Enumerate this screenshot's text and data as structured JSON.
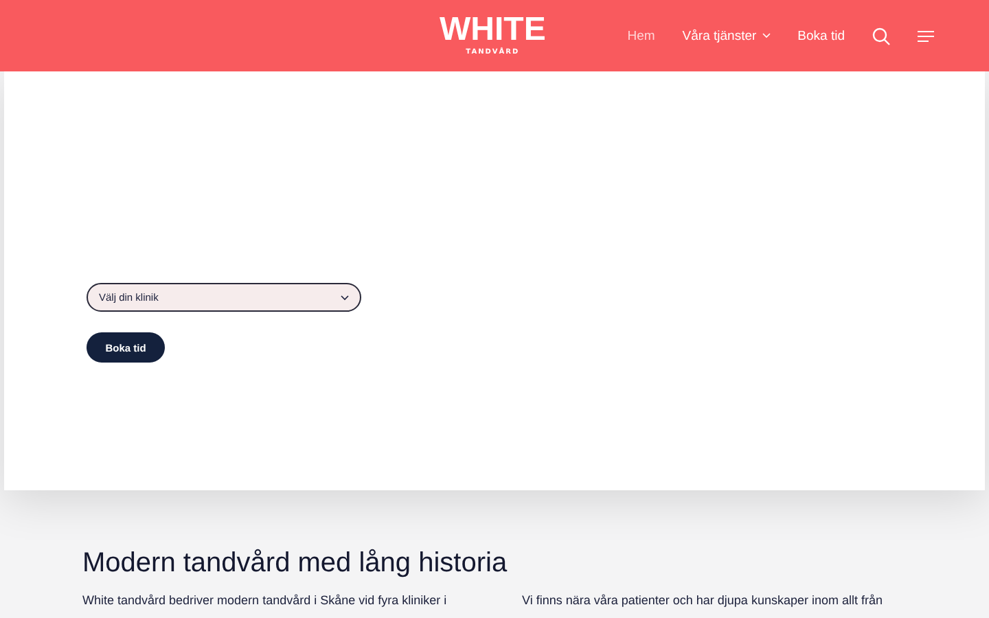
{
  "header": {
    "logo": {
      "word": "WHITE",
      "sub": "TANDVÅRD"
    },
    "nav": [
      {
        "label": "Hem",
        "kind": "link",
        "dimmed": true
      },
      {
        "label": "Våra tjänster",
        "kind": "dropdown",
        "dimmed": false
      },
      {
        "label": "Boka tid",
        "kind": "link",
        "dimmed": false
      }
    ]
  },
  "booking": {
    "select": {
      "placeholder": "Välj din klinik"
    },
    "button": "Boka tid"
  },
  "intro": {
    "title": "Modern tandvård med lång historia",
    "columns": [
      "White tandvård bedriver modern tandvård i Skåne vid fyra kliniker i",
      "Vi finns nära våra patienter och har djupa kunskaper inom allt från"
    ]
  }
}
